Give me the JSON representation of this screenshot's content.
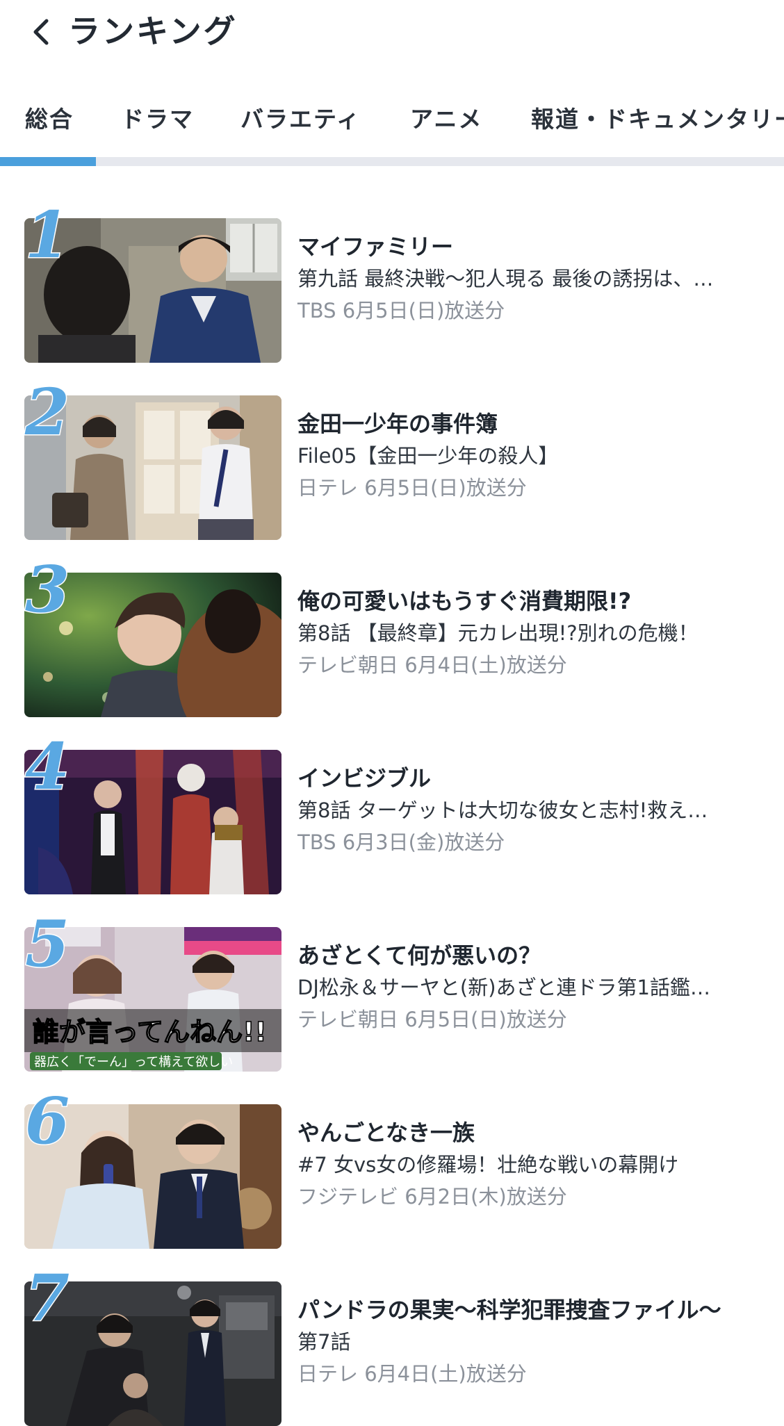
{
  "header": {
    "back_icon": "chevron-left-icon",
    "title": "ランキング"
  },
  "tabs": [
    {
      "label": "総合",
      "selected": true
    },
    {
      "label": "ドラマ",
      "selected": false
    },
    {
      "label": "バラエティ",
      "selected": false
    },
    {
      "label": "アニメ",
      "selected": false
    },
    {
      "label": "報道・ドキュメンタリー",
      "selected": false
    }
  ],
  "colors": {
    "accent": "#4a9fdc",
    "rank_number": "#5aa8e2",
    "meta_text": "#8b919a",
    "tab_track": "#e6e8ee"
  },
  "rankings": [
    {
      "rank": "1",
      "title": "マイファミリー",
      "episode": "第九話 最終決戦〜犯人現る 最後の誘拐は、…",
      "meta": "TBS 6月5日(日)放送分"
    },
    {
      "rank": "2",
      "title": "金田一少年の事件簿",
      "episode": "File05【金田一少年の殺人】",
      "meta": "日テレ 6月5日(日)放送分"
    },
    {
      "rank": "3",
      "title": "俺の可愛いはもうすぐ消費期限!?",
      "episode": "第8話 【最終章】元カレ出現!?別れの危機！",
      "meta": "テレビ朝日 6月4日(土)放送分"
    },
    {
      "rank": "4",
      "title": "インビジブル",
      "episode": "第8話 ターゲットは大切な彼女と志村!救え…",
      "meta": "TBS 6月3日(金)放送分"
    },
    {
      "rank": "5",
      "title": "あざとくて何が悪いの？",
      "episode": "DJ松永＆サーヤと(新)あざと連ドラ第1話鑑…",
      "meta": "テレビ朝日 6月5日(日)放送分",
      "thumb_caption_1": "誰が言ってんねん!!",
      "thumb_caption_2": "器広く「でーん」って構えて欲しい"
    },
    {
      "rank": "6",
      "title": "やんごとなき一族",
      "episode": "#7 女vs女の修羅場！壮絶な戦いの幕開け",
      "meta": "フジテレビ 6月2日(木)放送分"
    },
    {
      "rank": "7",
      "title": "パンドラの果実〜科学犯罪捜査ファイル〜",
      "episode": "第7話",
      "meta": "日テレ 6月4日(土)放送分"
    }
  ]
}
